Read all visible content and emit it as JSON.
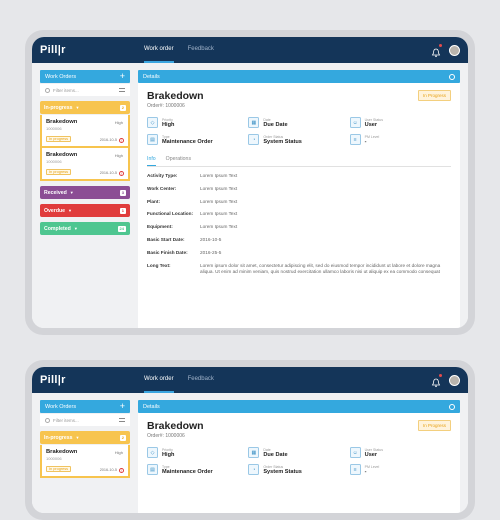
{
  "app": {
    "logo": "Pill|r",
    "nav": [
      "Work order",
      "Feedback"
    ]
  },
  "sidebar": {
    "title": "Work Orders",
    "add": "+",
    "filter_placeholder": "Filter items...",
    "groups": [
      {
        "label": "In-progress",
        "count": "2"
      },
      {
        "label": "Received",
        "count": "3"
      },
      {
        "label": "Overdue",
        "count": "1"
      },
      {
        "label": "Completed",
        "count": "24"
      }
    ],
    "cards": [
      {
        "title": "Brakedown",
        "number": "1000006",
        "priority": "High",
        "badge": "In progress",
        "date": "2016-10-5",
        "warn": "!"
      },
      {
        "title": "Brakedown",
        "number": "1000006",
        "priority": "High",
        "badge": "In progress",
        "date": "2016-10-5",
        "warn": "!"
      }
    ]
  },
  "details": {
    "header": "Details",
    "title": "Brakedown",
    "status": "In Progress",
    "order": "Order#: 1000006",
    "fields": [
      {
        "label": "Priority",
        "value": "High",
        "icon": "priority-icon"
      },
      {
        "label": "Date",
        "value": "Due Date",
        "icon": "calendar-icon"
      },
      {
        "label": "User Status",
        "value": "User",
        "icon": "user-icon"
      },
      {
        "label": "Type",
        "value": "Maintenance Order",
        "icon": "type-icon"
      },
      {
        "label": "Order Status",
        "value": "System Status",
        "icon": "status-icon"
      },
      {
        "label": "PM Level",
        "value": "-",
        "icon": "level-icon"
      }
    ],
    "tabs": [
      "Info",
      "Operations"
    ],
    "info": [
      {
        "k": "Activity Type:",
        "v": "Lorem Ipsum Text"
      },
      {
        "k": "Work Center:",
        "v": "Lorem Ipsum Text"
      },
      {
        "k": "Plant:",
        "v": "Lorem Ipsum Text"
      },
      {
        "k": "Functional Location:",
        "v": "Lorem Ipsum Text"
      },
      {
        "k": "Equipment:",
        "v": "Lorem Ipsum Text"
      },
      {
        "k": "Basic Start Date:",
        "v": "2016-10-5"
      },
      {
        "k": "Basic Finish Date:",
        "v": "2016-25-5"
      },
      {
        "k": "Long Text:",
        "v": "Lorem ipsum dolor sit amet, consectetur adipiscing elit, sed do eiusmod tempor incididunt ut labore et dolore magna aliqua. Ut enim ad minim veniam, quis nostrud exercitation ullamco laboris nisi ut aliquip ex ea commodo consequat"
      }
    ]
  },
  "colors": {
    "topbar": "#143559",
    "accent": "#34a8de",
    "inprogress": "#f7c44e",
    "received": "#8b4d94",
    "overdue": "#e03c3c",
    "completed": "#4ec690"
  }
}
